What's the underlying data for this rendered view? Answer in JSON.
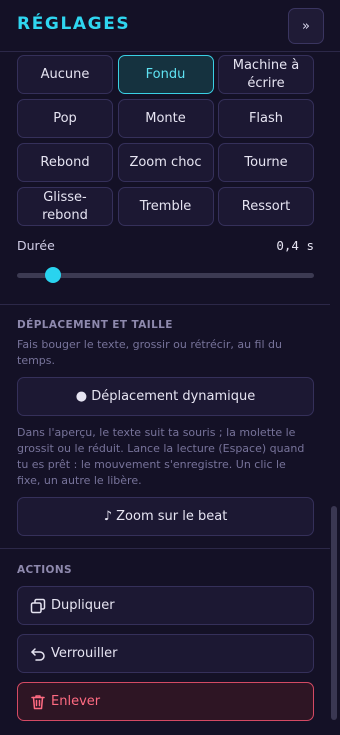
{
  "header": {
    "title": "RÉGLAGES",
    "collapse_label": "»"
  },
  "transitions": {
    "options": [
      {
        "label": "Aucune",
        "active": false
      },
      {
        "label": "Fondu",
        "active": true
      },
      {
        "label": "Machine à écrire",
        "active": false
      },
      {
        "label": "Pop",
        "active": false
      },
      {
        "label": "Monte",
        "active": false
      },
      {
        "label": "Flash",
        "active": false
      },
      {
        "label": "Rebond",
        "active": false
      },
      {
        "label": "Zoom choc",
        "active": false
      },
      {
        "label": "Tourne",
        "active": false
      },
      {
        "label": "Glisse-rebond",
        "active": false
      },
      {
        "label": "Tremble",
        "active": false
      },
      {
        "label": "Ressort",
        "active": false
      }
    ],
    "duration_label": "Durée",
    "duration_value": "0,4 s",
    "duration_fraction": 0.12
  },
  "movement": {
    "title": "DÉPLACEMENT ET TAILLE",
    "description": "Fais bouger le texte, grossir ou rétrécir, au fil du temps.",
    "dynamic_button": "● Déplacement dynamique",
    "help": "Dans l'aperçu, le texte suit ta souris ; la molette le grossit ou le réduit. Lance la lecture (Espace) quand tu es prêt : le mouvement s'enregistre. Un clic le fixe, un autre le libère.",
    "beat_button": "♪ Zoom sur le beat"
  },
  "actions": {
    "title": "ACTIONS",
    "duplicate": "Dupliquer",
    "lock": "Verrouiller",
    "remove": "Enlever"
  },
  "colors": {
    "accent": "#2fd6f0",
    "danger": "#ff6b82",
    "background": "#141126"
  },
  "icons": {
    "duplicate": "copy-icon",
    "lock": "undo-arrow-icon",
    "remove": "trash-icon"
  }
}
